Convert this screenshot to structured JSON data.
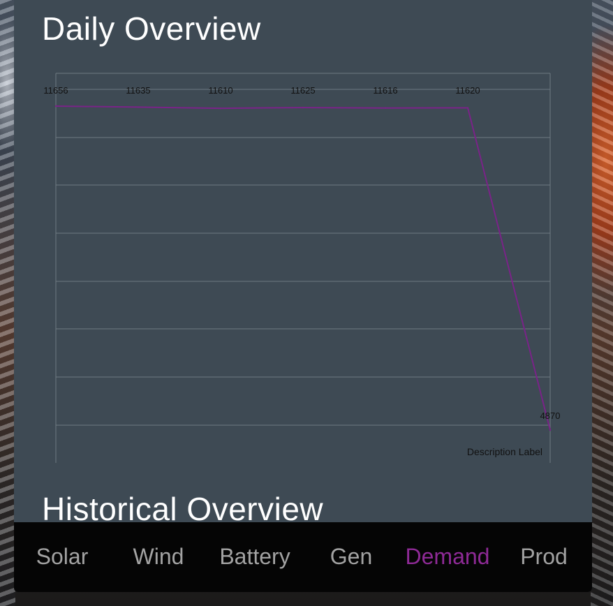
{
  "colors": {
    "panel": "#3e4a54",
    "line": "#7a2388",
    "grid": "#6f7a82",
    "tab_text": "#a3a3a3",
    "tab_active": "#8e2a96",
    "tabbar": "#050505"
  },
  "header": {
    "title": "Daily Overview"
  },
  "section2": {
    "title": "Historical Overview"
  },
  "chart_data": {
    "type": "line",
    "title": "",
    "xlabel": "",
    "ylabel": "",
    "description_label": "Description Label",
    "x": [
      0,
      1,
      2,
      3,
      4,
      5,
      6
    ],
    "series": [
      {
        "values": [
          11656,
          11635,
          11610,
          11625,
          11616,
          11620,
          4870
        ]
      }
    ],
    "value_labels": [
      "11656",
      "11635",
      "11610",
      "11625",
      "11616",
      "11620",
      "4870"
    ],
    "ylim": [
      4870,
      11656
    ],
    "grid": true,
    "legend": "none"
  },
  "tabs": [
    {
      "label": "Solar",
      "active": false
    },
    {
      "label": "Wind",
      "active": false
    },
    {
      "label": "Battery",
      "active": false
    },
    {
      "label": "Gen",
      "active": false
    },
    {
      "label": "Demand",
      "active": true
    },
    {
      "label": "Prod",
      "active": false
    }
  ]
}
